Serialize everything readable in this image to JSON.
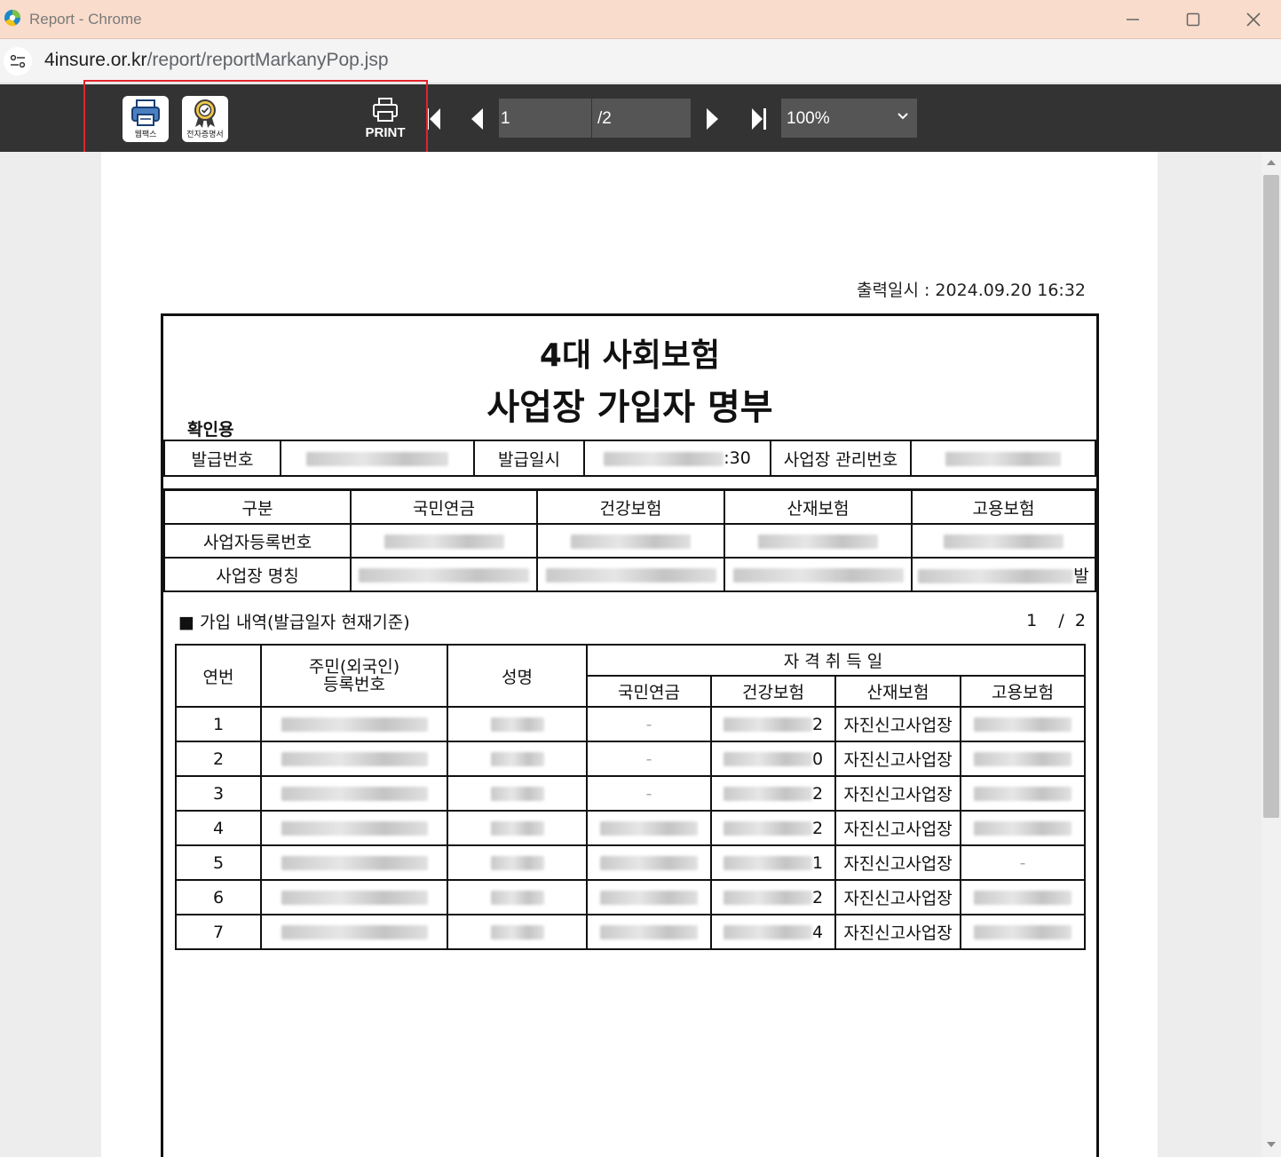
{
  "window": {
    "title": "Report - Chrome"
  },
  "address_bar": {
    "host": "4insure.or.kr",
    "path": "/report/reportMarkanyPop.jsp"
  },
  "toolbar": {
    "webfax_label": "웹팩스",
    "ecert_label": "전자증명서",
    "print_label": "PRINT",
    "current_page": "1",
    "total_pages": "/2",
    "zoom": "100%"
  },
  "document": {
    "issue_datetime": "출력일시 : 2024.09.20 16:32",
    "title_line1": "4대 사회보험",
    "title_line2": "사업장 가입자 명부",
    "confirm_label": "확인용",
    "info": {
      "issue_no_label": "발급번호",
      "issue_date_label": "발급일시",
      "issue_date_suffix": ":30",
      "site_mgmt_no_label": "사업장 관리번호"
    },
    "biz": {
      "header_label": "구분",
      "columns": [
        "국민연금",
        "건강보험",
        "산재보험",
        "고용보험"
      ],
      "reg_no_label": "사업자등록번호",
      "site_name_label": "사업장 명칭",
      "site_name_suffix": "발"
    },
    "section_title": "■ 가입 내역(발급일자 현재기준)",
    "page_indicator": "1    /  2",
    "members": {
      "headers": {
        "seq": "연번",
        "id_line1": "주민(외국인)",
        "id_line2": "등록번호",
        "name": "성명",
        "acquire_date": "자격취득일",
        "pension": "국민연금",
        "health": "건강보험",
        "accident": "산재보험",
        "employment": "고용보험"
      },
      "rows": [
        {
          "seq": "1",
          "pension": "-",
          "health_suffix": "2",
          "accident": "자진신고사업장",
          "employment": ""
        },
        {
          "seq": "2",
          "pension": "-",
          "health_suffix": "0",
          "accident": "자진신고사업장",
          "employment": ""
        },
        {
          "seq": "3",
          "pension": "-",
          "health_suffix": "2",
          "accident": "자진신고사업장",
          "employment": ""
        },
        {
          "seq": "4",
          "pension": "",
          "health_suffix": "2",
          "accident": "자진신고사업장",
          "employment": ""
        },
        {
          "seq": "5",
          "pension": "",
          "health_suffix": "1",
          "accident": "자진신고사업장",
          "employment": "-"
        },
        {
          "seq": "6",
          "pension": "",
          "health_suffix": "2",
          "accident": "자진신고사업장",
          "employment": ""
        },
        {
          "seq": "7",
          "pension": "",
          "health_suffix": "4",
          "accident": "자진신고사업장",
          "employment": ""
        }
      ]
    }
  },
  "colors": {
    "titlebar_bg": "#f9dccb",
    "toolbar_bg": "#333333",
    "highlight_border": "#e0242c"
  },
  "icons": [
    "chrome-app-icon",
    "minimize-icon",
    "maximize-icon",
    "close-icon",
    "site-info-icon",
    "webfax-icon",
    "ecert-icon",
    "printer-icon",
    "first-page-icon",
    "prev-page-icon",
    "next-page-icon",
    "last-page-icon",
    "chevron-down-icon"
  ]
}
